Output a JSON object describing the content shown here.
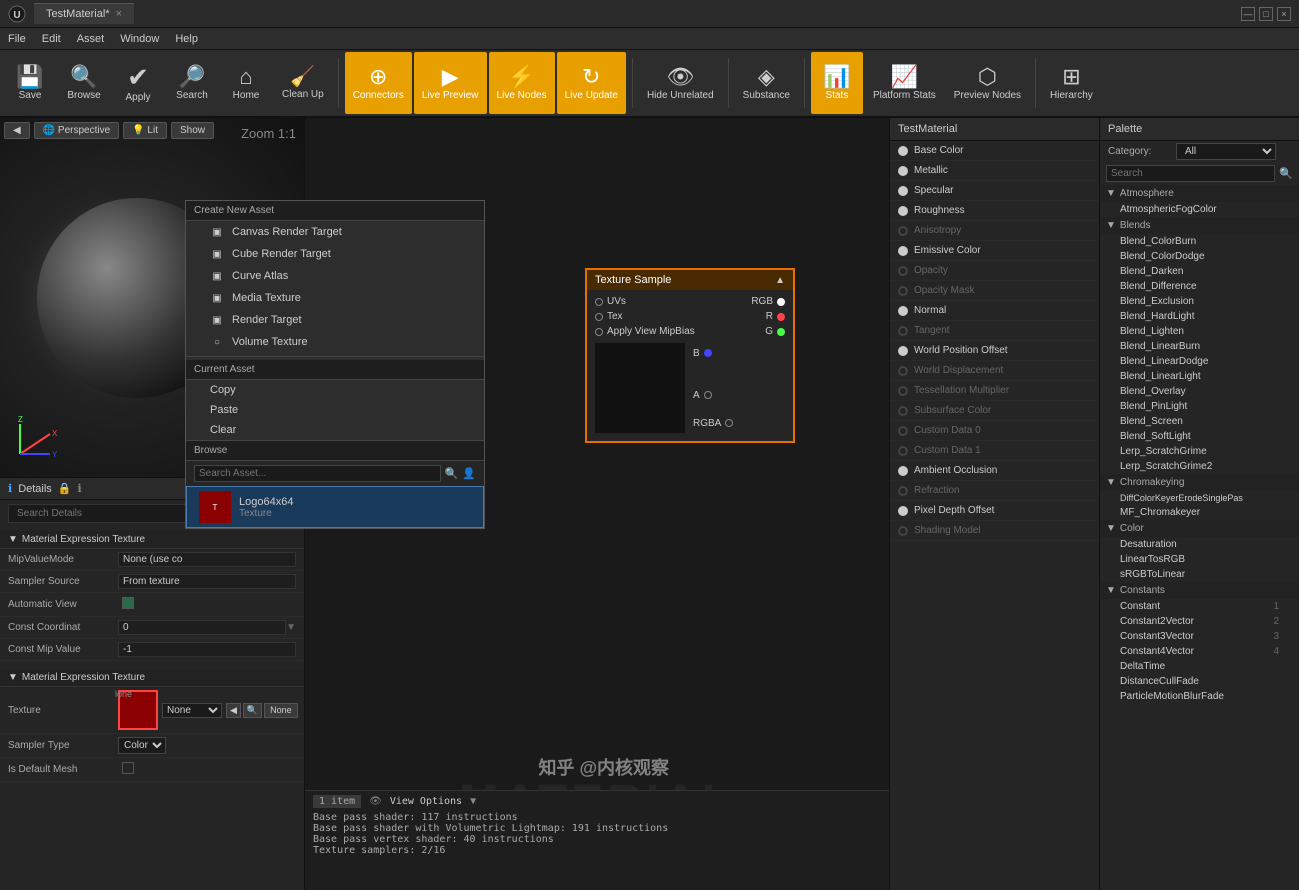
{
  "titleBar": {
    "logo": "U",
    "tab": "TestMaterial*",
    "closeBtn": "×",
    "winBtns": [
      "—",
      "□",
      "×"
    ]
  },
  "menuBar": {
    "items": [
      "File",
      "Edit",
      "Asset",
      "Window",
      "Help"
    ]
  },
  "toolbar": {
    "buttons": [
      {
        "id": "save",
        "label": "Save",
        "icon": "💾",
        "active": false
      },
      {
        "id": "browse",
        "label": "Browse",
        "icon": "🔍",
        "active": false
      },
      {
        "id": "apply",
        "label": "Apply",
        "icon": "✔",
        "active": false
      },
      {
        "id": "search",
        "label": "Search",
        "icon": "🔎",
        "active": false
      },
      {
        "id": "home",
        "label": "Home",
        "icon": "⌂",
        "active": false
      },
      {
        "id": "cleanup",
        "label": "Clean Up",
        "icon": "🧹",
        "active": false
      },
      {
        "id": "connectors",
        "label": "Connectors",
        "icon": "⊕",
        "active": true
      },
      {
        "id": "live-preview",
        "label": "Live Preview",
        "icon": "▶",
        "active": true
      },
      {
        "id": "live-nodes",
        "label": "Live Nodes",
        "icon": "⚡",
        "active": true
      },
      {
        "id": "live-update",
        "label": "Live Update",
        "icon": "↻",
        "active": true
      },
      {
        "id": "hide-unrelated",
        "label": "Hide Unrelated",
        "icon": "👁",
        "active": false
      },
      {
        "id": "substance",
        "label": "Substance",
        "icon": "◈",
        "active": false
      },
      {
        "id": "stats",
        "label": "Stats",
        "icon": "📊",
        "active": true
      },
      {
        "id": "platform-stats",
        "label": "Platform Stats",
        "icon": "📈",
        "active": false
      },
      {
        "id": "preview-nodes",
        "label": "Preview Nodes",
        "icon": "⬡",
        "active": false
      },
      {
        "id": "hierarchy",
        "label": "Hierarchy",
        "icon": "⊞",
        "active": false
      }
    ]
  },
  "viewport": {
    "buttons": [
      "◀",
      "Perspective",
      "Lit",
      "Show"
    ],
    "zoomLabel": "Zoom 1:1"
  },
  "contextMenu": {
    "createHeader": "Create New Asset",
    "createItems": [
      {
        "icon": "▣",
        "label": "Canvas Render Target"
      },
      {
        "icon": "▣",
        "label": "Cube Render Target"
      },
      {
        "icon": "▣",
        "label": "Curve Atlas"
      },
      {
        "icon": "▣",
        "label": "Media Texture"
      },
      {
        "icon": "▣",
        "label": "Render Target"
      },
      {
        "icon": "○",
        "label": "Volume Texture"
      }
    ],
    "currentHeader": "Current Asset",
    "currentItems": [
      "Copy",
      "Paste",
      "Clear"
    ],
    "browseHeader": "Browse",
    "searchPlaceholder": "Search Asset...",
    "assetName": "Logo64x64",
    "assetType": "Texture"
  },
  "details": {
    "title": "Details",
    "searchPlaceholder": "Search Details",
    "sections": [
      {
        "label": "Material Expression Texture",
        "rows": [
          {
            "label": "MipValueMode",
            "value": "None (use co"
          },
          {
            "label": "Sampler Source",
            "value": "From texture"
          },
          {
            "label": "Automatic View",
            "value": "checkbox"
          },
          {
            "label": "Const Coordinat",
            "value": "0"
          },
          {
            "label": "Const Mip Value",
            "value": "-1"
          }
        ]
      },
      {
        "label": "Material Expression Texture",
        "rows": [
          {
            "label": "Texture",
            "value": "None"
          },
          {
            "label": "Sampler Type",
            "value": "Color"
          },
          {
            "label": "Is Default Mesh",
            "value": "checkbox"
          }
        ]
      }
    ]
  },
  "materialProps": {
    "title": "TestMaterial",
    "pins": [
      {
        "label": "Base Color",
        "active": true
      },
      {
        "label": "Metallic",
        "active": true
      },
      {
        "label": "Specular",
        "active": true
      },
      {
        "label": "Roughness",
        "active": true
      },
      {
        "label": "Anisotropy",
        "active": false,
        "disabled": true
      },
      {
        "label": "Emissive Color",
        "active": true
      },
      {
        "label": "Opacity",
        "active": false,
        "disabled": true
      },
      {
        "label": "Opacity Mask",
        "active": false,
        "disabled": true
      },
      {
        "label": "Normal",
        "active": true
      },
      {
        "label": "Tangent",
        "active": false,
        "disabled": true
      },
      {
        "label": "World Position Offset",
        "active": true
      },
      {
        "label": "World Displacement",
        "active": false,
        "disabled": true
      },
      {
        "label": "Tessellation Multiplier",
        "active": false,
        "disabled": true
      },
      {
        "label": "Subsurface Color",
        "active": false,
        "disabled": true
      },
      {
        "label": "Custom Data 0",
        "active": false,
        "disabled": true
      },
      {
        "label": "Custom Data 1",
        "active": false,
        "disabled": true
      },
      {
        "label": "Ambient Occlusion",
        "active": true
      },
      {
        "label": "Refraction",
        "active": false,
        "disabled": true
      },
      {
        "label": "Pixel Depth Offset",
        "active": true
      },
      {
        "label": "Shading Model",
        "active": false,
        "disabled": true
      }
    ]
  },
  "palette": {
    "title": "Palette",
    "categoryLabel": "Category:",
    "categoryValue": "All",
    "searchPlaceholder": "Search",
    "groups": [
      {
        "label": "Atmosphere",
        "items": [
          {
            "label": "AtmosphericFogColor",
            "count": null
          }
        ]
      },
      {
        "label": "Blends",
        "items": [
          {
            "label": "Blend_ColorBurn",
            "count": null
          },
          {
            "label": "Blend_ColorDodge",
            "count": null
          },
          {
            "label": "Blend_Darken",
            "count": null
          },
          {
            "label": "Blend_Difference",
            "count": null
          },
          {
            "label": "Blend_Exclusion",
            "count": null
          },
          {
            "label": "Blend_HardLight",
            "count": null
          },
          {
            "label": "Blend_Lighten",
            "count": null
          },
          {
            "label": "Blend_LinearBurn",
            "count": null
          },
          {
            "label": "Blend_LinearDodge",
            "count": null
          },
          {
            "label": "Blend_LinearLight",
            "count": null
          },
          {
            "label": "Blend_Overlay",
            "count": null
          },
          {
            "label": "Blend_PinLight",
            "count": null
          },
          {
            "label": "Blend_Screen",
            "count": null
          },
          {
            "label": "Blend_SoftLight",
            "count": null
          },
          {
            "label": "Lerp_ScratchGrime",
            "count": null
          },
          {
            "label": "Lerp_ScratchGrime2",
            "count": null
          }
        ]
      },
      {
        "label": "Chromakeying",
        "items": [
          {
            "label": "DiffColorKeyerErodeSinglePas",
            "count": null
          },
          {
            "label": "MF_Chromakeyer",
            "count": null
          }
        ]
      },
      {
        "label": "Color",
        "items": [
          {
            "label": "Desaturation",
            "count": null
          },
          {
            "label": "LinearTosRGB",
            "count": null
          },
          {
            "label": "sRGBToLinear",
            "count": null
          }
        ]
      },
      {
        "label": "Constants",
        "items": [
          {
            "label": "Constant",
            "count": "1"
          },
          {
            "label": "Constant2Vector",
            "count": "2"
          },
          {
            "label": "Constant3Vector",
            "count": "3"
          },
          {
            "label": "Constant4Vector",
            "count": "4"
          },
          {
            "label": "DeltaTime",
            "count": null
          },
          {
            "label": "DistanceCullFade",
            "count": null
          },
          {
            "label": "ParticleMotionBlurFade",
            "count": null
          }
        ]
      }
    ]
  },
  "textureNode": {
    "title": "Texture Sample",
    "pins_left": [
      "UVs",
      "Tex",
      "Apply View MipBias"
    ],
    "pins_right": [
      "RGB",
      "R",
      "G",
      "B",
      "A",
      "RGBA"
    ]
  },
  "log": {
    "itemCount": "1 item",
    "viewOptions": "View Options",
    "lines": [
      "Base pass shader: 117 instructions",
      "Base pass shader with Volumetric Lightmap: 191 instructions",
      "Base pass vertex shader: 40 instructions",
      "Texture samplers: 2/16"
    ]
  },
  "watermark": "MATERIAL",
  "zhihuWatermark": "知乎 @内核观察"
}
